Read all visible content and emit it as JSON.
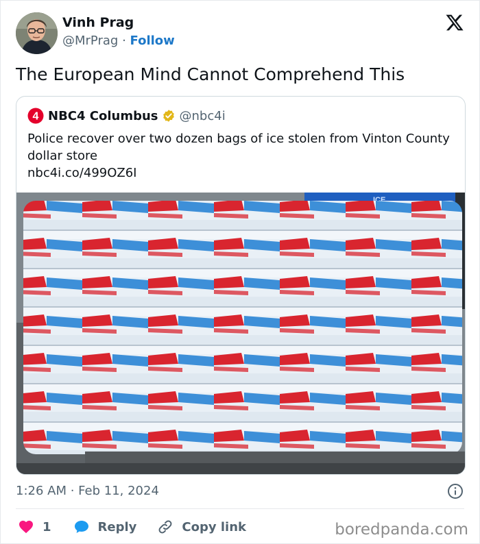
{
  "author": {
    "name": "Vinh Prag",
    "handle": "@MrPrag",
    "separator": "·",
    "follow_label": "Follow"
  },
  "logo_icon": "x-logo-icon",
  "tweet": {
    "text": "The European Mind Cannot Comprehend This"
  },
  "quoted": {
    "account_name": "NBC4 Columbus",
    "handle": "@nbc4i",
    "logo_glyph": "4",
    "verified_icon": "gold-verified-badge-icon",
    "text": "Police recover over two dozen bags of ice stolen from Vinton County dollar store",
    "link": "nbc4i.co/499OZ6I"
  },
  "meta": {
    "timestamp": "1:26 AM · Feb 11, 2024"
  },
  "actions": {
    "like_count": "1",
    "reply_label": "Reply",
    "copy_label": "Copy link"
  },
  "watermark": "boredpanda.com",
  "colors": {
    "follow": "#1d78c8",
    "heart": "#f91880",
    "reply_bubble": "#1d9bf0",
    "badge_gold": "#e2b719",
    "nbc_red": "#e4002b"
  }
}
